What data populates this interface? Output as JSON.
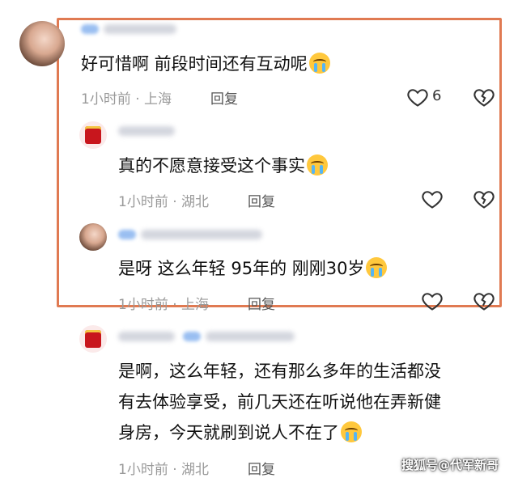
{
  "comments": [
    {
      "text": "好可惜啊 前段时间还有互动呢",
      "time": "1小时前",
      "location": "上海",
      "reply_label": "回复",
      "likes": "6"
    },
    {
      "text": "真的不愿意接受这个事实",
      "time": "1小时前",
      "location": "湖北",
      "reply_label": "回复"
    },
    {
      "text": "是呀 这么年轻 95年的 刚刚30岁",
      "time": "1小时前",
      "location": "上海",
      "reply_label": "回复"
    },
    {
      "text_lines": [
        "是啊，这么年轻，还有那么多年的生活都没",
        "有去体验享受，前几天还在听说他在弄新健",
        "身房，今天就刷到说人不在了"
      ],
      "time": "1小时前",
      "location": "湖北",
      "reply_label": "回复"
    }
  ],
  "separator": " · ",
  "watermark": "搜狐号@代军新哥",
  "colors": {
    "highlight": "#e07a52",
    "meta": "#9a9a9a"
  }
}
